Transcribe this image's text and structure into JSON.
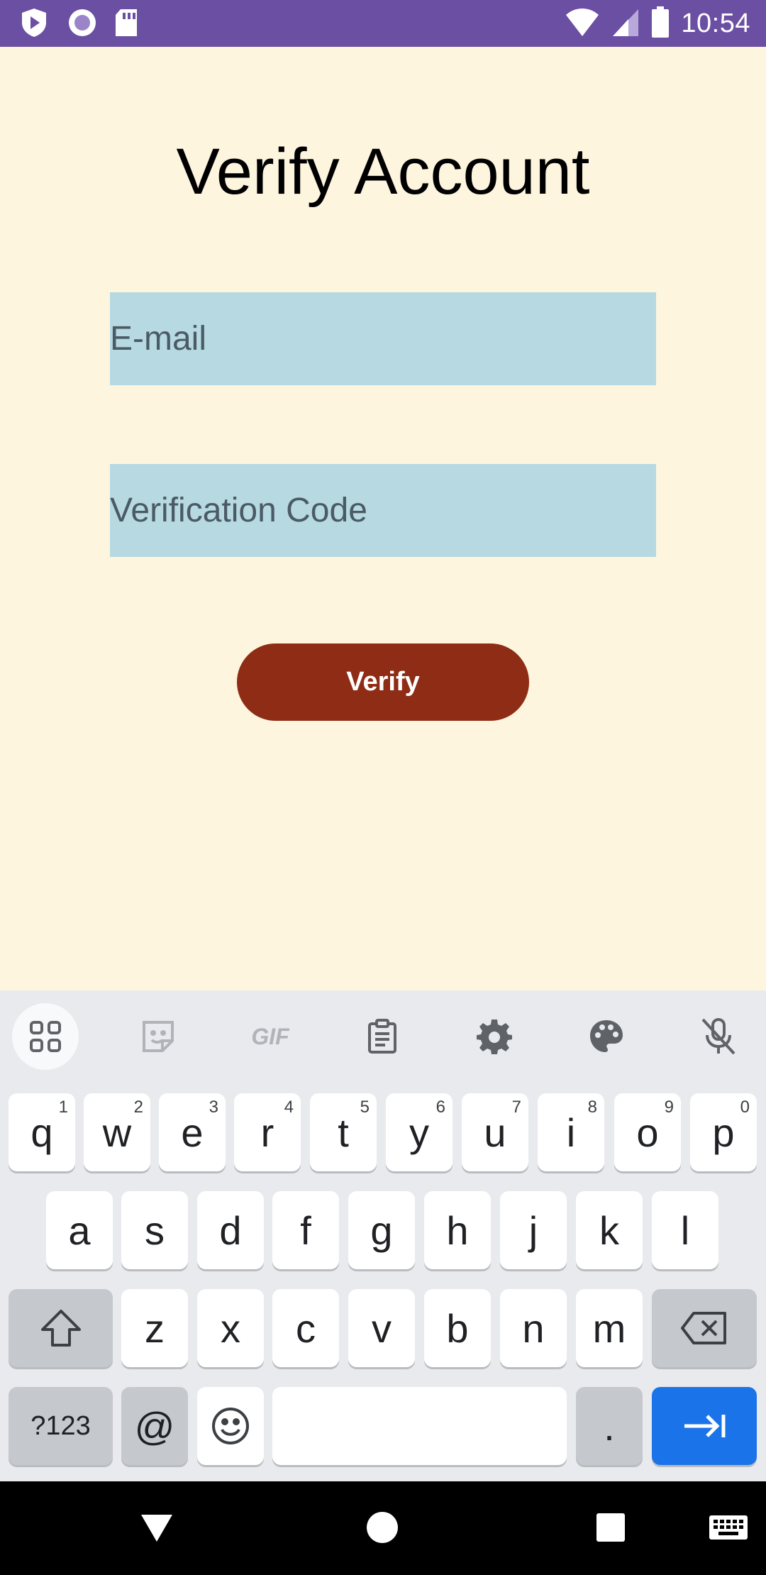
{
  "status_bar": {
    "time": "10:54",
    "left_icons": [
      "shield-play-icon",
      "circle-record-icon",
      "sd-card-icon"
    ],
    "right_icons": [
      "wifi-icon",
      "signal-icon",
      "battery-icon"
    ]
  },
  "page": {
    "title": "Verify Account",
    "email": {
      "value": "",
      "placeholder": "E-mail"
    },
    "code": {
      "value": "",
      "placeholder": "Verification Code"
    },
    "verify_label": "Verify"
  },
  "keyboard": {
    "toolbar": [
      "apps-icon",
      "sticker-icon",
      "gif-icon",
      "clipboard-icon",
      "settings-icon",
      "palette-icon",
      "mic-off-icon"
    ],
    "gif_label": "GIF",
    "row1": [
      {
        "key": "q",
        "num": "1"
      },
      {
        "key": "w",
        "num": "2"
      },
      {
        "key": "e",
        "num": "3"
      },
      {
        "key": "r",
        "num": "4"
      },
      {
        "key": "t",
        "num": "5"
      },
      {
        "key": "y",
        "num": "6"
      },
      {
        "key": "u",
        "num": "7"
      },
      {
        "key": "i",
        "num": "8"
      },
      {
        "key": "o",
        "num": "9"
      },
      {
        "key": "p",
        "num": "0"
      }
    ],
    "row2": [
      "a",
      "s",
      "d",
      "f",
      "g",
      "h",
      "j",
      "k",
      "l"
    ],
    "row3": [
      "z",
      "x",
      "c",
      "v",
      "b",
      "n",
      "m"
    ],
    "symbols_label": "?123",
    "at_label": "@",
    "period_label": ".",
    "accent_color": "#1a73e8"
  },
  "colors": {
    "status_bar": "#6b4fa3",
    "background": "#fdf5de",
    "field": "#b6d9e2",
    "button": "#8e2c15"
  }
}
